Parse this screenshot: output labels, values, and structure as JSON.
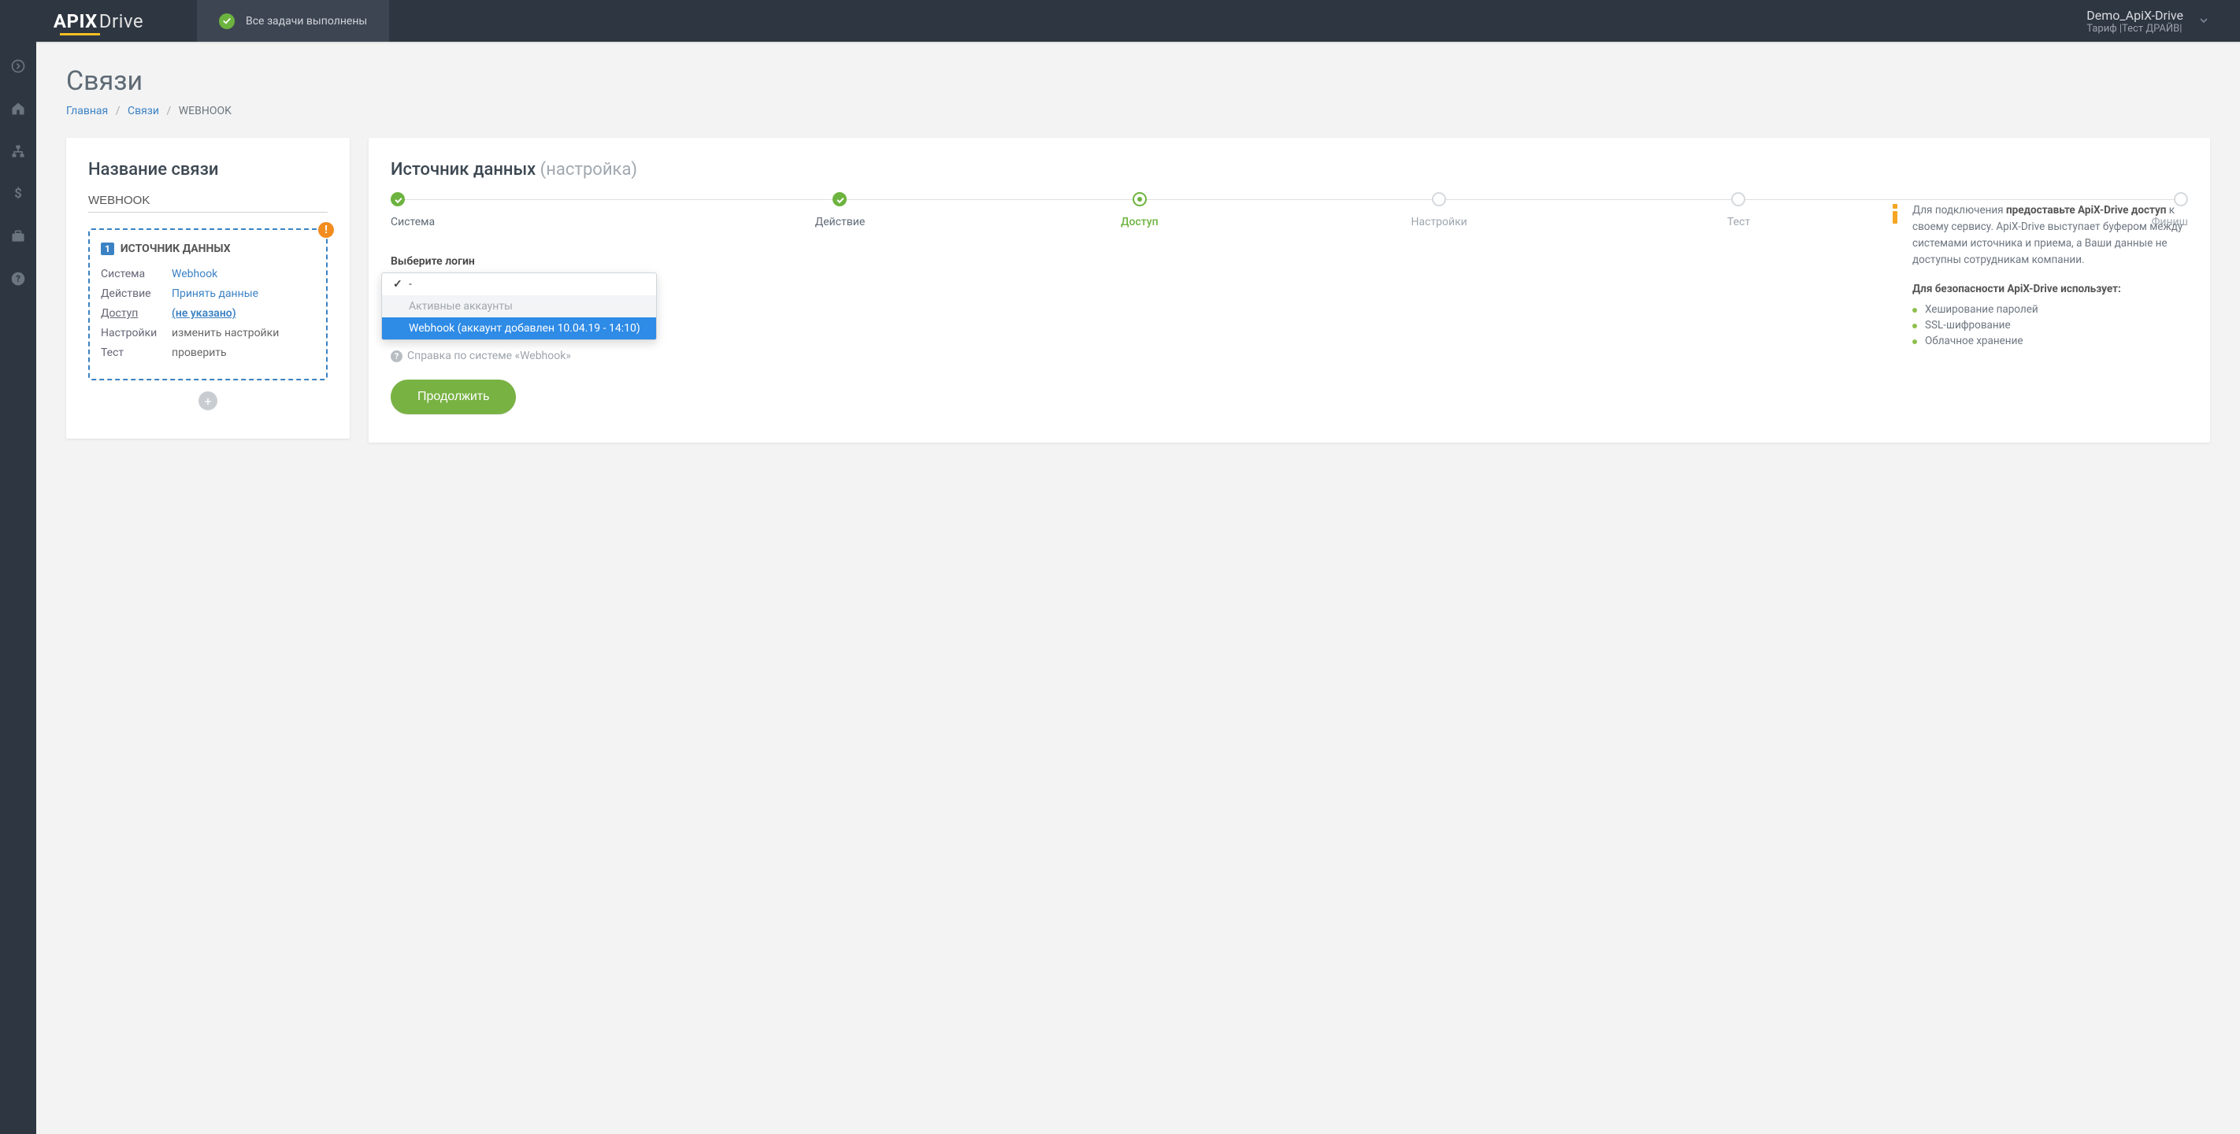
{
  "topbar": {
    "logo_api": "API",
    "logo_x": "X",
    "logo_drive": "Drive",
    "status": "Все задачи выполнены",
    "account_name": "Demo_ApiX-Drive",
    "tariff_line": "Тариф |Тест ДРАЙВ|"
  },
  "page": {
    "title": "Связи",
    "breadcrumb_home": "Главная",
    "breadcrumb_links": "Связи",
    "breadcrumb_current": "WEBHOOK"
  },
  "left_card": {
    "heading": "Название связи",
    "name_value": "WEBHOOK",
    "source_num": "1",
    "source_title": "ИСТОЧНИК ДАННЫХ",
    "rows": {
      "system_k": "Система",
      "system_v": "Webhook",
      "action_k": "Действие",
      "action_v": "Принять данные",
      "access_k": "Доступ",
      "access_v": "(не указано)",
      "settings_k": "Настройки",
      "settings_v": "изменить настройки",
      "test_k": "Тест",
      "test_v": "проверить"
    }
  },
  "right_card": {
    "heading": "Источник данных",
    "heading_muted": "(настройка)",
    "steps": [
      {
        "label": "Система",
        "state": "done"
      },
      {
        "label": "Действие",
        "state": "done"
      },
      {
        "label": "Доступ",
        "state": "active"
      },
      {
        "label": "Настройки",
        "state": "pending"
      },
      {
        "label": "Тест",
        "state": "pending"
      },
      {
        "label": "Финиш",
        "state": "pending"
      }
    ],
    "login_label": "Выберите логин",
    "dropdown": {
      "current": "-",
      "group_label": "Активные аккаунты",
      "option": "Webhook (аккаунт добавлен 10.04.19 - 14:10)"
    },
    "help_text": "Справка по системе «Webhook»",
    "continue_btn": "Продолжить",
    "info": {
      "para": "Для подключения ",
      "para_bold": "предоставьте ApiX-Drive доступ",
      "para_tail": " к своему сервису. ApiX-Drive выступает буфером между системами источника и приема, а Ваши данные не доступны сотрудникам компании.",
      "security_heading": "Для безопасности ApiX-Drive использует:",
      "bullets": [
        "Хеширование паролей",
        "SSL-шифрование",
        "Облачное хранение"
      ]
    }
  }
}
